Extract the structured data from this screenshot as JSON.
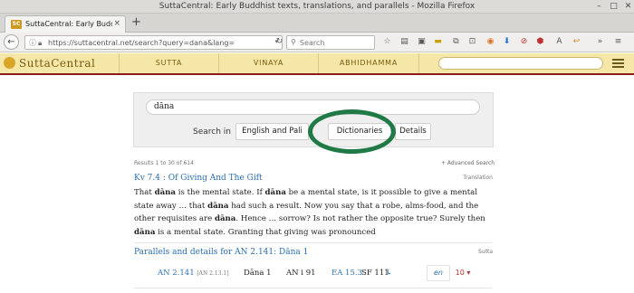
{
  "window": {
    "title": "SuttaCentral: Early Buddhist texts, translations, and parallels - Mozilla Firefox"
  },
  "tab": {
    "favicon_text": "SC",
    "label": "SuttaCentral: Early Buddhi",
    "close": "×"
  },
  "newtab": "+",
  "nav": {
    "url": "https://suttacentral.net/search?query=dana&lang=",
    "search_placeholder": "Search"
  },
  "site": {
    "logo": "SuttaCentral",
    "menu": [
      "SUTTA",
      "VINAYA",
      "ABHIDHAMMA"
    ],
    "brand_color": "#f4e7a8",
    "accent": "#8a1c1c"
  },
  "search": {
    "query": "dāna",
    "search_in_label": "Search in",
    "buttons": [
      "English and Pali",
      "Dictionaries",
      "Details"
    ],
    "highlight_color": "#1f7a45"
  },
  "results": {
    "count_text": "Results 1 to 30 of 614",
    "advanced": "+ Advanced Search",
    "first": {
      "title": "Kv 7.4 : Of Giving And The Gift",
      "type": "Translation"
    },
    "second": {
      "title": "Parallels and details for AN 2.141: Dāna 1",
      "type": "Sutta"
    },
    "parallel_row": {
      "ref": "AN 2.141",
      "ref_small": "[AN 2.13.1]",
      "name": "Dāna 1",
      "vol": "AN i 91",
      "par": "EA 15.3",
      "par2": "SF 111",
      "arrow": "↳",
      "lang": "en",
      "count": "10 ▾"
    }
  }
}
